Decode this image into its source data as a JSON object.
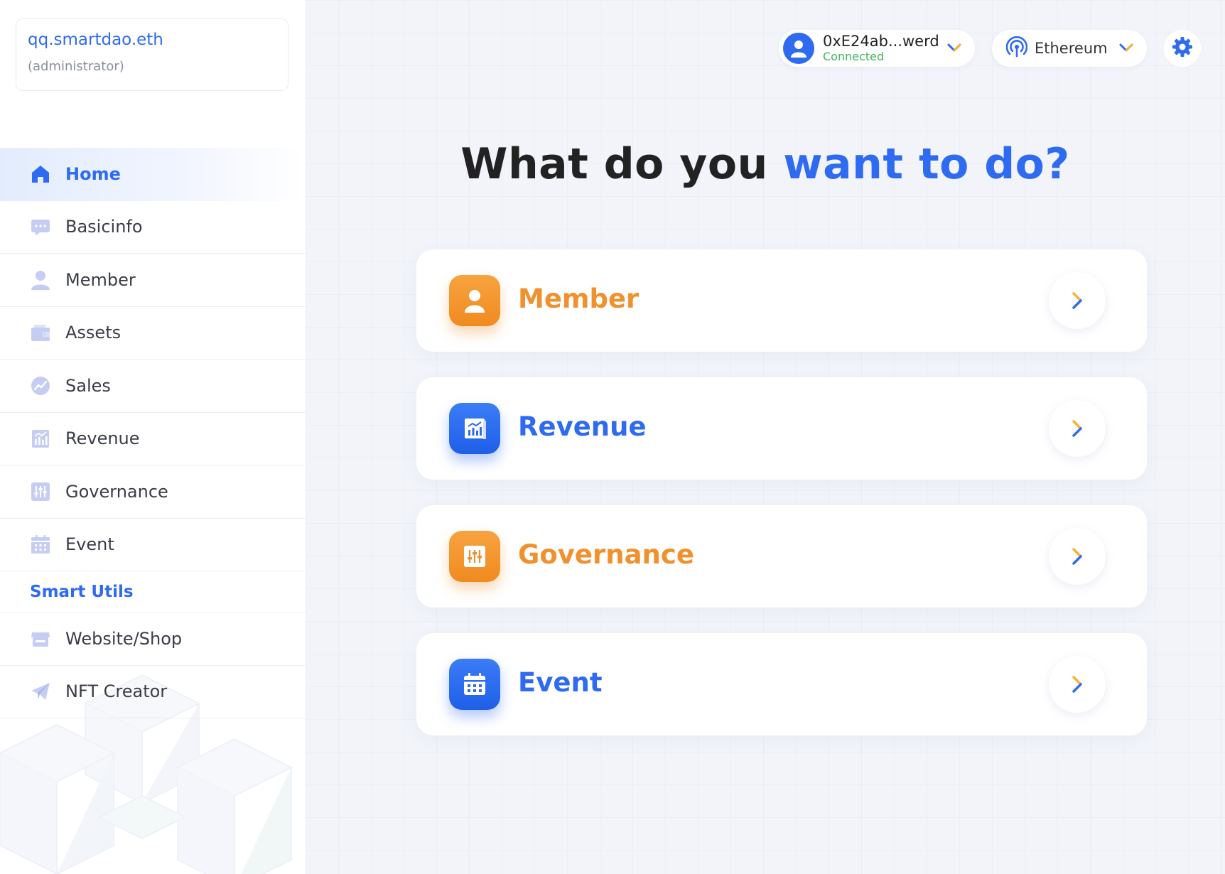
{
  "account": {
    "name": "qq.smartdao.eth",
    "role": "(administrator)"
  },
  "sidebar": {
    "items": [
      {
        "label": "Home",
        "icon": "home-icon",
        "active": true
      },
      {
        "label": "Basicinfo",
        "icon": "chat-icon"
      },
      {
        "label": "Member",
        "icon": "user-icon"
      },
      {
        "label": "Assets",
        "icon": "wallet-icon"
      },
      {
        "label": "Sales",
        "icon": "trend-icon"
      },
      {
        "label": "Revenue",
        "icon": "chart-icon"
      },
      {
        "label": "Governance",
        "icon": "sliders-icon"
      },
      {
        "label": "Event",
        "icon": "calendar-icon"
      }
    ],
    "section_title": "Smart Utils",
    "utils": [
      {
        "label": "Website/Shop",
        "icon": "shop-icon"
      },
      {
        "label": "NFT Creator",
        "icon": "paper-plane-icon"
      }
    ]
  },
  "topbar": {
    "wallet_address": "0xE24ab...werd",
    "wallet_status": "Connected",
    "network": "Ethereum"
  },
  "main": {
    "headline_part1": "What do you ",
    "headline_part2": "want to do?",
    "cards": [
      {
        "label": "Member",
        "color": "#f0912d",
        "icon": "user-icon"
      },
      {
        "label": "Revenue",
        "color": "#2e6bf0",
        "icon": "chart-icon"
      },
      {
        "label": "Governance",
        "color": "#f0912d",
        "icon": "sliders-icon"
      },
      {
        "label": "Event",
        "color": "#2e6bf0",
        "icon": "calendar-icon"
      }
    ]
  },
  "colors": {
    "accent_blue": "#2e6bf0",
    "accent_orange": "#f0912d",
    "status_green": "#3fb55b"
  }
}
